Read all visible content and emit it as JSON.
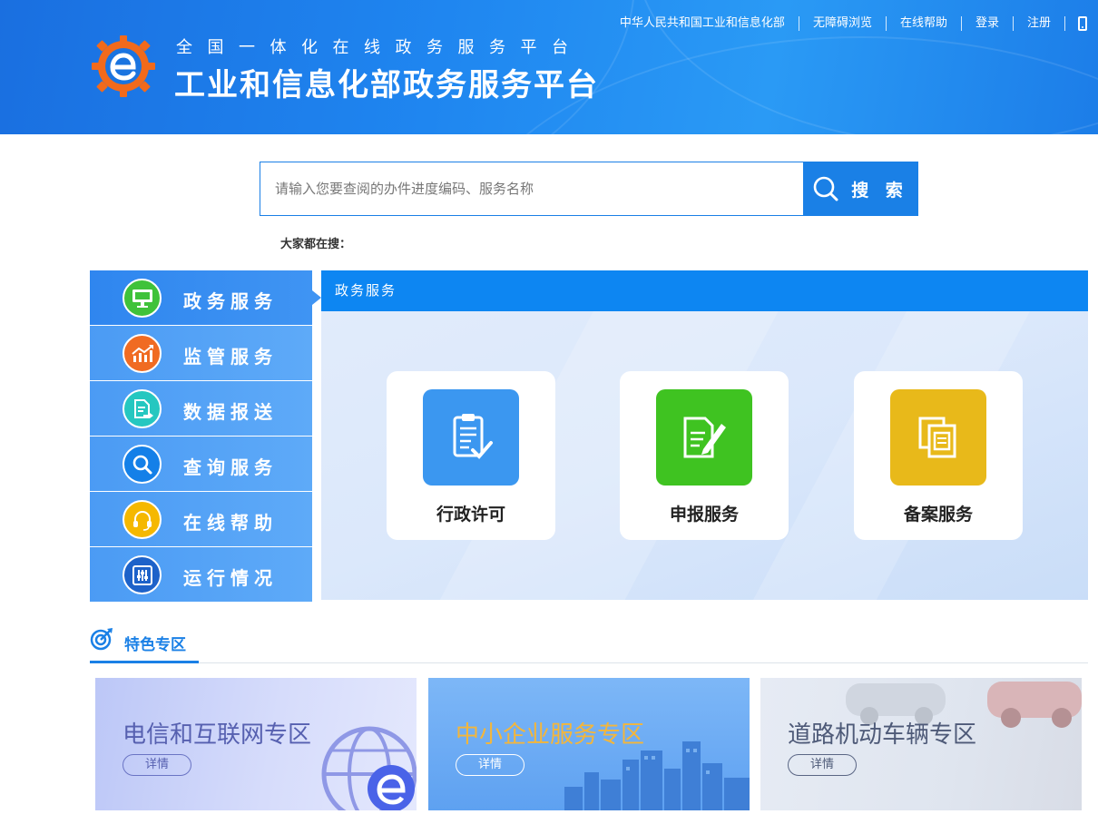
{
  "header": {
    "top_links": [
      "中华人民共和国工业和信息化部",
      "无障碍浏览",
      "在线帮助",
      "登录",
      "注册"
    ],
    "subtitle": "全国一体化在线政务服务平台",
    "title": "工业和信息化部政务服务平台"
  },
  "search": {
    "placeholder": "请输入您要查阅的办件进度编码、服务名称",
    "button_label": "搜 索",
    "hot_label": "大家都在搜："
  },
  "sidebar": {
    "items": [
      {
        "label": "政务服务",
        "icon": "monitor-icon",
        "color": "#3fc23a"
      },
      {
        "label": "监管服务",
        "icon": "chart-icon",
        "color": "#f06b22"
      },
      {
        "label": "数据报送",
        "icon": "document-send-icon",
        "color": "#25c7c0"
      },
      {
        "label": "查询服务",
        "icon": "search-icon",
        "color": "#1480e8"
      },
      {
        "label": "在线帮助",
        "icon": "headset-icon",
        "color": "#f5b800"
      },
      {
        "label": "运行情况",
        "icon": "sliders-icon",
        "color": "#1d62c9"
      }
    ]
  },
  "panel": {
    "title": "政务服务",
    "cards": [
      {
        "label": "行政许可",
        "icon": "clipboard-check-icon",
        "color": "#3b97f0"
      },
      {
        "label": "申报服务",
        "icon": "document-edit-icon",
        "color": "#3fc321"
      },
      {
        "label": "备案服务",
        "icon": "files-copy-icon",
        "color": "#e8b91a"
      }
    ]
  },
  "featured": {
    "title": "特色专区",
    "zones": [
      {
        "title": "电信和互联网专区",
        "button": "详情"
      },
      {
        "title": "中小企业服务专区",
        "button": "详情"
      },
      {
        "title": "道路机动车辆专区",
        "button": "详情"
      }
    ]
  }
}
